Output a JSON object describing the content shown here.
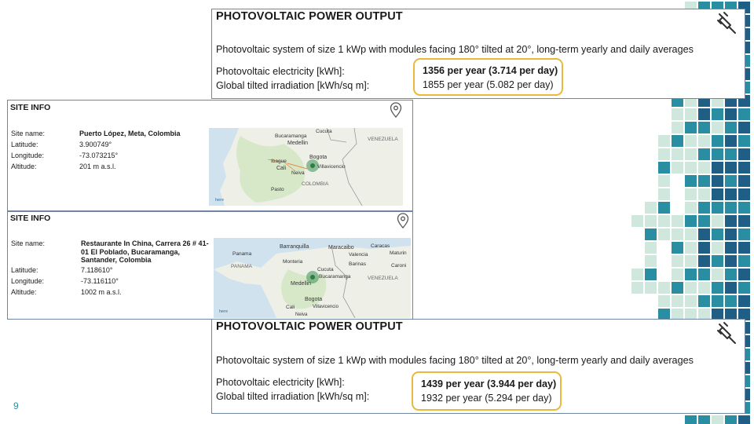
{
  "slide": {
    "page_number": "9"
  },
  "pv_top": {
    "title": "PHOTOVOLTAIC POWER OUTPUT",
    "description": "Photovoltaic system of size 1 kWp with modules facing 180° tilted at 20°, long-term yearly and daily averages",
    "electricity_label": "Photovoltaic electricity [kWh]:",
    "electricity_value": "1356 per year (3.714 per day)",
    "irradiation_label": "Global tilted irradiation [kWh/sq m]:",
    "irradiation_value": "1855 per year (5.082 per day)",
    "icon": "plug-icon"
  },
  "site1": {
    "title": "SITE INFO",
    "icon": "location-pin-icon",
    "name_label": "Site name:",
    "name_value": "Puerto López, Meta, Colombia",
    "lat_label": "Latitude:",
    "lat_value": "3.900749°",
    "lon_label": "Longitude:",
    "lon_value": "-73.073215°",
    "alt_label": "Altitude:",
    "alt_value": "201 m a.s.l.",
    "map_labels": [
      "Bucaramanga",
      "Cucuta",
      "Medellin",
      "Bogota",
      "Ibague",
      "Cali",
      "Neiva",
      "Villavicencio",
      "Pasto",
      "COLOMBIA",
      "VENEZUELA",
      "here"
    ]
  },
  "site2": {
    "title": "SITE INFO",
    "icon": "location-pin-icon",
    "name_label": "Site name:",
    "name_value": "Restaurante In China, Carrera 26 # 41-01 El Poblado, Bucaramanga, Santander, Colombia",
    "lat_label": "Latitude:",
    "lat_value": "7.118610°",
    "lon_label": "Longitude:",
    "lon_value": "-73.116110°",
    "alt_label": "Altitude:",
    "alt_value": "1002 m a.s.l.",
    "map_labels": [
      "Barranquilla",
      "Maracaibo",
      "Caracas",
      "Panama",
      "Valencia",
      "Maturin",
      "PANAMA",
      "Monteria",
      "Barinas",
      "Caroni",
      "Cucuta",
      "Bucaramanga",
      "VENEZUELA",
      "Medellin",
      "Bogota",
      "Cali",
      "Villavicencio",
      "Neiva",
      "here"
    ]
  },
  "pv_bottom": {
    "title": "PHOTOVOLTAIC POWER OUTPUT",
    "description": "Photovoltaic system of size 1 kWp with modules facing 180° tilted at 20°, long-term yearly and daily averages",
    "electricity_label": "Photovoltaic electricity [kWh]:",
    "electricity_value": "1439 per year (3.944 per day)",
    "irradiation_label": "Global tilted irradiation [kWh/sq m]:",
    "irradiation_value": "1932 per year (5.294 per day)",
    "icon": "plug-icon"
  },
  "colors": {
    "highlight_border": "#eab83b",
    "panel_border": "#6f86a3",
    "deco_dark": "#1f5f86",
    "deco_teal": "#2a8ea3",
    "deco_light": "#cfe7dc",
    "page_number": "#2f8fa8"
  }
}
